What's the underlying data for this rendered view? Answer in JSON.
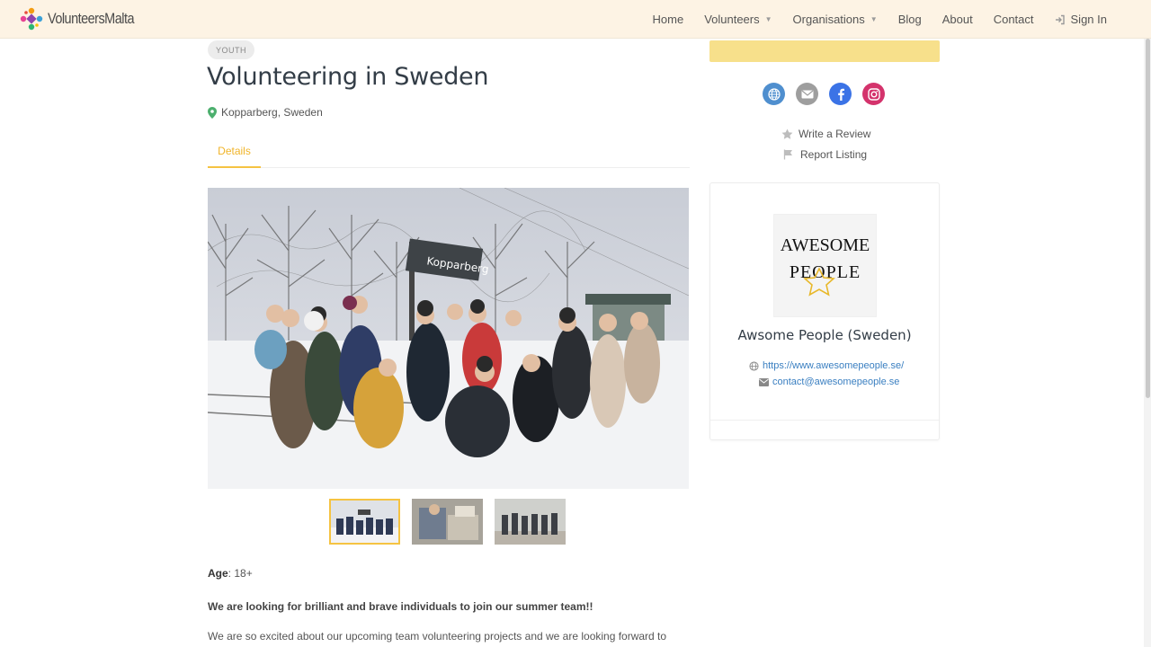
{
  "header": {
    "logo_text": "VolunteersMalta",
    "nav": [
      {
        "label": "Home"
      },
      {
        "label": "Volunteers"
      },
      {
        "label": "Organisations"
      },
      {
        "label": "Blog"
      },
      {
        "label": "About"
      },
      {
        "label": "Contact"
      },
      {
        "label": "Sign In"
      }
    ]
  },
  "listing": {
    "badge": "YOUTH",
    "title": "Volunteering in Sweden",
    "location": "Kopparberg, Sweden",
    "tab_details": "Details",
    "photo_sign": "Kopparberg",
    "age_label": "Age",
    "age_value": ": 18+",
    "lead": "We are looking for brilliant and brave individuals to join our summer team!!",
    "body": "We are so excited about our upcoming team volunteering projects and we are looking forward to"
  },
  "sidebar": {
    "write_review": "Write a Review",
    "report_listing": "Report Listing",
    "org": {
      "logo_line1": "AWESOME",
      "logo_line2": "PEOPLE",
      "name": "Awsome People (Sweden)",
      "website": "https://www.awesomepeople.se/",
      "email": "contact@awesomepeople.se"
    }
  },
  "colors": {
    "accent": "#f5c342",
    "header_bg": "#fdf3e4",
    "link": "#3a7fc1",
    "globe": "#4f8fcf",
    "mail": "#9e9e9e",
    "facebook": "#3b73e6",
    "instagram": "#d4336c"
  },
  "icons": [
    "globe-icon",
    "mail-icon",
    "facebook-icon",
    "instagram-icon",
    "star-icon",
    "flag-icon",
    "map-pin-icon",
    "sign-in-icon",
    "chevron-down-icon"
  ]
}
